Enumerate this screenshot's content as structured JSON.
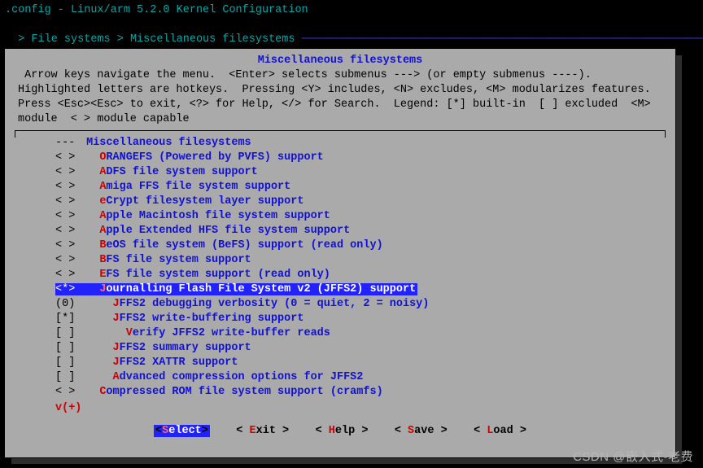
{
  "title_line": ".config - Linux/arm 5.2.0 Kernel Configuration",
  "breadcrumb_prefix": "> ",
  "breadcrumb_parent": "File systems",
  "breadcrumb_sep": " > ",
  "breadcrumb_current": "Miscellaneous filesystems",
  "breadcrumb_fill": " ─────────────────────────────────────────────────────────────",
  "box_title": "Miscellaneous filesystems",
  "help_text": " Arrow keys navigate the menu.  <Enter> selects submenus ---> (or empty submenus ----). Highlighted letters are hotkeys.  Pressing <Y> includes, <N> excludes, <M> modularizes features.  Press <Esc><Esc> to exit, <?> for Help, </> for Search.  Legend: [*] built-in  [ ] excluded  <M> module  < > module capable",
  "items": [
    {
      "state": "---",
      "indent": "",
      "hot": "",
      "text": "Miscellaneous filesystems",
      "sel": false
    },
    {
      "state": "< >",
      "indent": "  ",
      "hot": "O",
      "text": "RANGEFS (Powered by PVFS) support",
      "sel": false
    },
    {
      "state": "< >",
      "indent": "  ",
      "hot": "A",
      "text": "DFS file system support",
      "sel": false
    },
    {
      "state": "< >",
      "indent": "  ",
      "hot": "A",
      "text": "miga FFS file system support",
      "sel": false
    },
    {
      "state": "< >",
      "indent": "  ",
      "hot": "e",
      "text": "Crypt filesystem layer support",
      "sel": false
    },
    {
      "state": "< >",
      "indent": "  ",
      "hot": "A",
      "text": "pple Macintosh file system support",
      "sel": false
    },
    {
      "state": "< >",
      "indent": "  ",
      "hot": "A",
      "text": "pple Extended HFS file system support",
      "sel": false
    },
    {
      "state": "< >",
      "indent": "  ",
      "hot": "B",
      "text": "eOS file system (BeFS) support (read only)",
      "sel": false
    },
    {
      "state": "< >",
      "indent": "  ",
      "hot": "B",
      "text": "FS file system support",
      "sel": false
    },
    {
      "state": "< >",
      "indent": "  ",
      "hot": "E",
      "text": "FS file system support (read only)",
      "sel": false
    },
    {
      "state": "<*>",
      "indent": "  ",
      "hot": "J",
      "text": "ournalling Flash File System v2 (JFFS2) support",
      "sel": true
    },
    {
      "state": "(0)",
      "indent": "    ",
      "hot": "J",
      "text": "FFS2 debugging verbosity (0 = quiet, 2 = noisy)",
      "sel": false
    },
    {
      "state": "[*]",
      "indent": "    ",
      "hot": "J",
      "text": "FFS2 write-buffering support",
      "sel": false
    },
    {
      "state": "[ ]",
      "indent": "      ",
      "hot": "V",
      "text": "erify JFFS2 write-buffer reads",
      "sel": false
    },
    {
      "state": "[ ]",
      "indent": "    ",
      "hot": "J",
      "text": "FFS2 summary support",
      "sel": false
    },
    {
      "state": "[ ]",
      "indent": "    ",
      "hot": "J",
      "text": "FFS2 XATTR support",
      "sel": false
    },
    {
      "state": "[ ]",
      "indent": "    ",
      "hot": "A",
      "text": "dvanced compression options for JFFS2",
      "sel": false
    },
    {
      "state": "< >",
      "indent": "  ",
      "hot": "C",
      "text": "ompressed ROM file system support (cramfs)",
      "sel": false
    }
  ],
  "more_indicator": "v(+)",
  "buttons": [
    {
      "label": "Select",
      "hot": "S",
      "active": true
    },
    {
      "label": "Exit",
      "hot": "E",
      "active": false
    },
    {
      "label": "Help",
      "hot": "H",
      "active": false
    },
    {
      "label": "Save",
      "hot": "S",
      "active": false
    },
    {
      "label": "Load",
      "hot": "L",
      "active": false
    }
  ],
  "watermark": "CSDN @嵌入式-老费"
}
